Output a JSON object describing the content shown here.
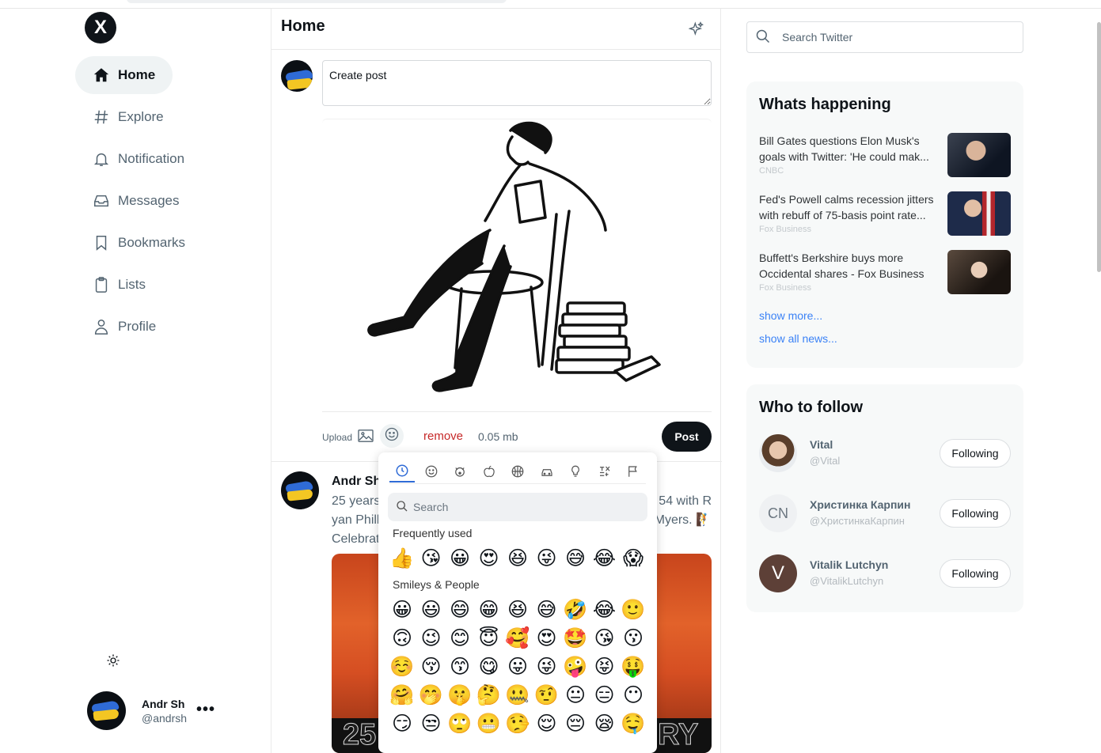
{
  "sidebar": {
    "logo": "X",
    "items": [
      {
        "label": "Home",
        "icon": "home-icon"
      },
      {
        "label": "Explore",
        "icon": "hash-icon"
      },
      {
        "label": "Notification",
        "icon": "bell-icon"
      },
      {
        "label": "Messages",
        "icon": "inbox-icon"
      },
      {
        "label": "Bookmarks",
        "icon": "bookmark-icon"
      },
      {
        "label": "Lists",
        "icon": "clipboard-icon"
      },
      {
        "label": "Profile",
        "icon": "user-icon"
      }
    ],
    "user": {
      "name": "Andr Sh",
      "handle": "@andrsh"
    }
  },
  "main": {
    "title": "Home",
    "composer": {
      "value": "Create post",
      "upload_label": "Upload",
      "remove_label": "remove",
      "file_size": "0.05 mb",
      "post_label": "Post"
    },
    "tweet": {
      "name": "Andr Sh",
      "line1_left": "25 years",
      "line1_right": "54 with R",
      "line2_left": "yan Phill",
      "line2_right": "Myers. 🧗",
      "line3": "Celebrat",
      "image_text_left": "25",
      "image_text_right": "RY"
    }
  },
  "emoji_picker": {
    "categories": [
      "recent-icon",
      "smiley-icon",
      "animal-icon",
      "food-icon",
      "sport-icon",
      "travel-icon",
      "object-icon",
      "symbol-icon",
      "flag-icon"
    ],
    "search_placeholder": "Search",
    "frequent_label": "Frequently used",
    "frequent": [
      "👍",
      "😘",
      "😀",
      "😍",
      "😆",
      "😜",
      "😅",
      "😂",
      "😱"
    ],
    "smileys_label": "Smileys & People",
    "smileys": [
      [
        "😀",
        "😃",
        "😄",
        "😁",
        "😆",
        "😅",
        "🤣",
        "😂",
        "🙂"
      ],
      [
        "🙃",
        "😉",
        "😊",
        "😇",
        "🥰",
        "😍",
        "🤩",
        "😘",
        "😗"
      ],
      [
        "☺️",
        "😚",
        "😙",
        "😋",
        "😛",
        "😜",
        "🤪",
        "😝",
        "🤑"
      ],
      [
        "🤗",
        "🤭",
        "🤫",
        "🤔",
        "🤐",
        "🤨",
        "😐",
        "😑",
        "😶"
      ],
      [
        "😏",
        "😒",
        "🙄",
        "😬",
        "🤥",
        "😌",
        "😔",
        "😪",
        "🤤"
      ]
    ]
  },
  "right": {
    "search_placeholder": "Search Twitter",
    "whats_happening": {
      "title": "Whats happening",
      "news": [
        {
          "text": "Bill Gates questions Elon Musk's goals with Twitter: 'He could mak...",
          "source": "CNBC"
        },
        {
          "text": "Fed's Powell calms recession jitters with rebuff of 75-basis point rate...",
          "source": "Fox Business"
        },
        {
          "text": "Buffett's Berkshire buys more Occidental shares - Fox Business",
          "source": "Fox Business"
        }
      ],
      "show_more": "show more...",
      "show_all": "show all news..."
    },
    "who_to_follow": {
      "title": "Who to follow",
      "people": [
        {
          "name": "Vital",
          "handle": "@Vital",
          "avatar": "",
          "button": "Following"
        },
        {
          "name": "Христинка Карпин",
          "handle": "@ХристинкаКарпин",
          "avatar": "CN",
          "button": "Following"
        },
        {
          "name": "Vitalik Lutchyn",
          "handle": "@VitalikLutchyn",
          "avatar": "V",
          "button": "Following"
        }
      ]
    }
  },
  "colors": {
    "accent": "#3b82f6",
    "dark": "#0f1419",
    "danger": "#c62828",
    "muted": "#536471"
  }
}
